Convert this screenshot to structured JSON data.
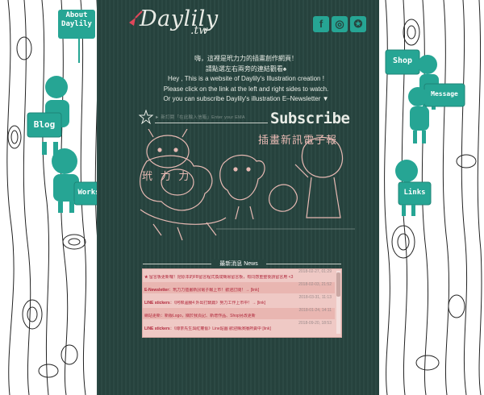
{
  "brand": {
    "name": "Daylily",
    "suffix": ".tw"
  },
  "social": [
    {
      "icon": "facebook-icon",
      "glyph": "f"
    },
    {
      "icon": "instagram-icon",
      "glyph": "◎"
    },
    {
      "icon": "weibo-icon",
      "glyph": "✪"
    }
  ],
  "nav_left": {
    "about": "About\nDaylily",
    "blog": "Blog",
    "works": "Works"
  },
  "nav_right": {
    "shop": "Shop",
    "message": "Message",
    "links": "Links"
  },
  "intro": [
    "嗨，這裡是玳力力的插畫創作網頁！",
    "請點選左右兩旁的連結觀看♠",
    "Hey , This is a website of Daylily's Illustration creation !",
    "Please click on the link at the left and right sides to watch.",
    "Or you can subscribe Daylily's illustration E–Newsletter ▼"
  ],
  "subscribe": {
    "placeholder": "► 新訂閱「在此輸入信箱」Enter your EMAIL ►",
    "button": "Subscribe",
    "headline": "插畫新訊電子報",
    "mascot_text": "玳 力 力"
  },
  "news": {
    "title": "最新消息 News",
    "items": [
      {
        "date": "2018-02-27, 01:29",
        "label": "★",
        "text": "留言板更新囉！把原本的FB留言程式換成簡易留言板，有同感重整後請留言用 <3"
      },
      {
        "date": "2018-02-03, 21:52",
        "label": "E-Newsletter",
        "text": "：玳力力插畫新訊電子報上市！歡迎訂閱！→ [link]"
      },
      {
        "date": "2018-03-31, 11:13",
        "label": "LINE stickers",
        "text": "：《阿棉溫腸4 外出打鍋篇》努力工作上市中！→ [link]"
      },
      {
        "date": "2018-01-24, 14:11",
        "label": "",
        "text": "網站更新：新版Logo，關於我頁記、新增作品、Shop另改更新"
      },
      {
        "date": "2018-09-20, 18:53",
        "label": "LINE stickers",
        "text": "：《綠茶先生與紅蘿蔔》Line貼圖 歡迎購演播熱賣中 [link]"
      }
    ]
  },
  "colors": {
    "accent": "#26a594",
    "panel": "#27453f",
    "news_bg": "#efc9c5",
    "news_text": "#b0263a"
  }
}
